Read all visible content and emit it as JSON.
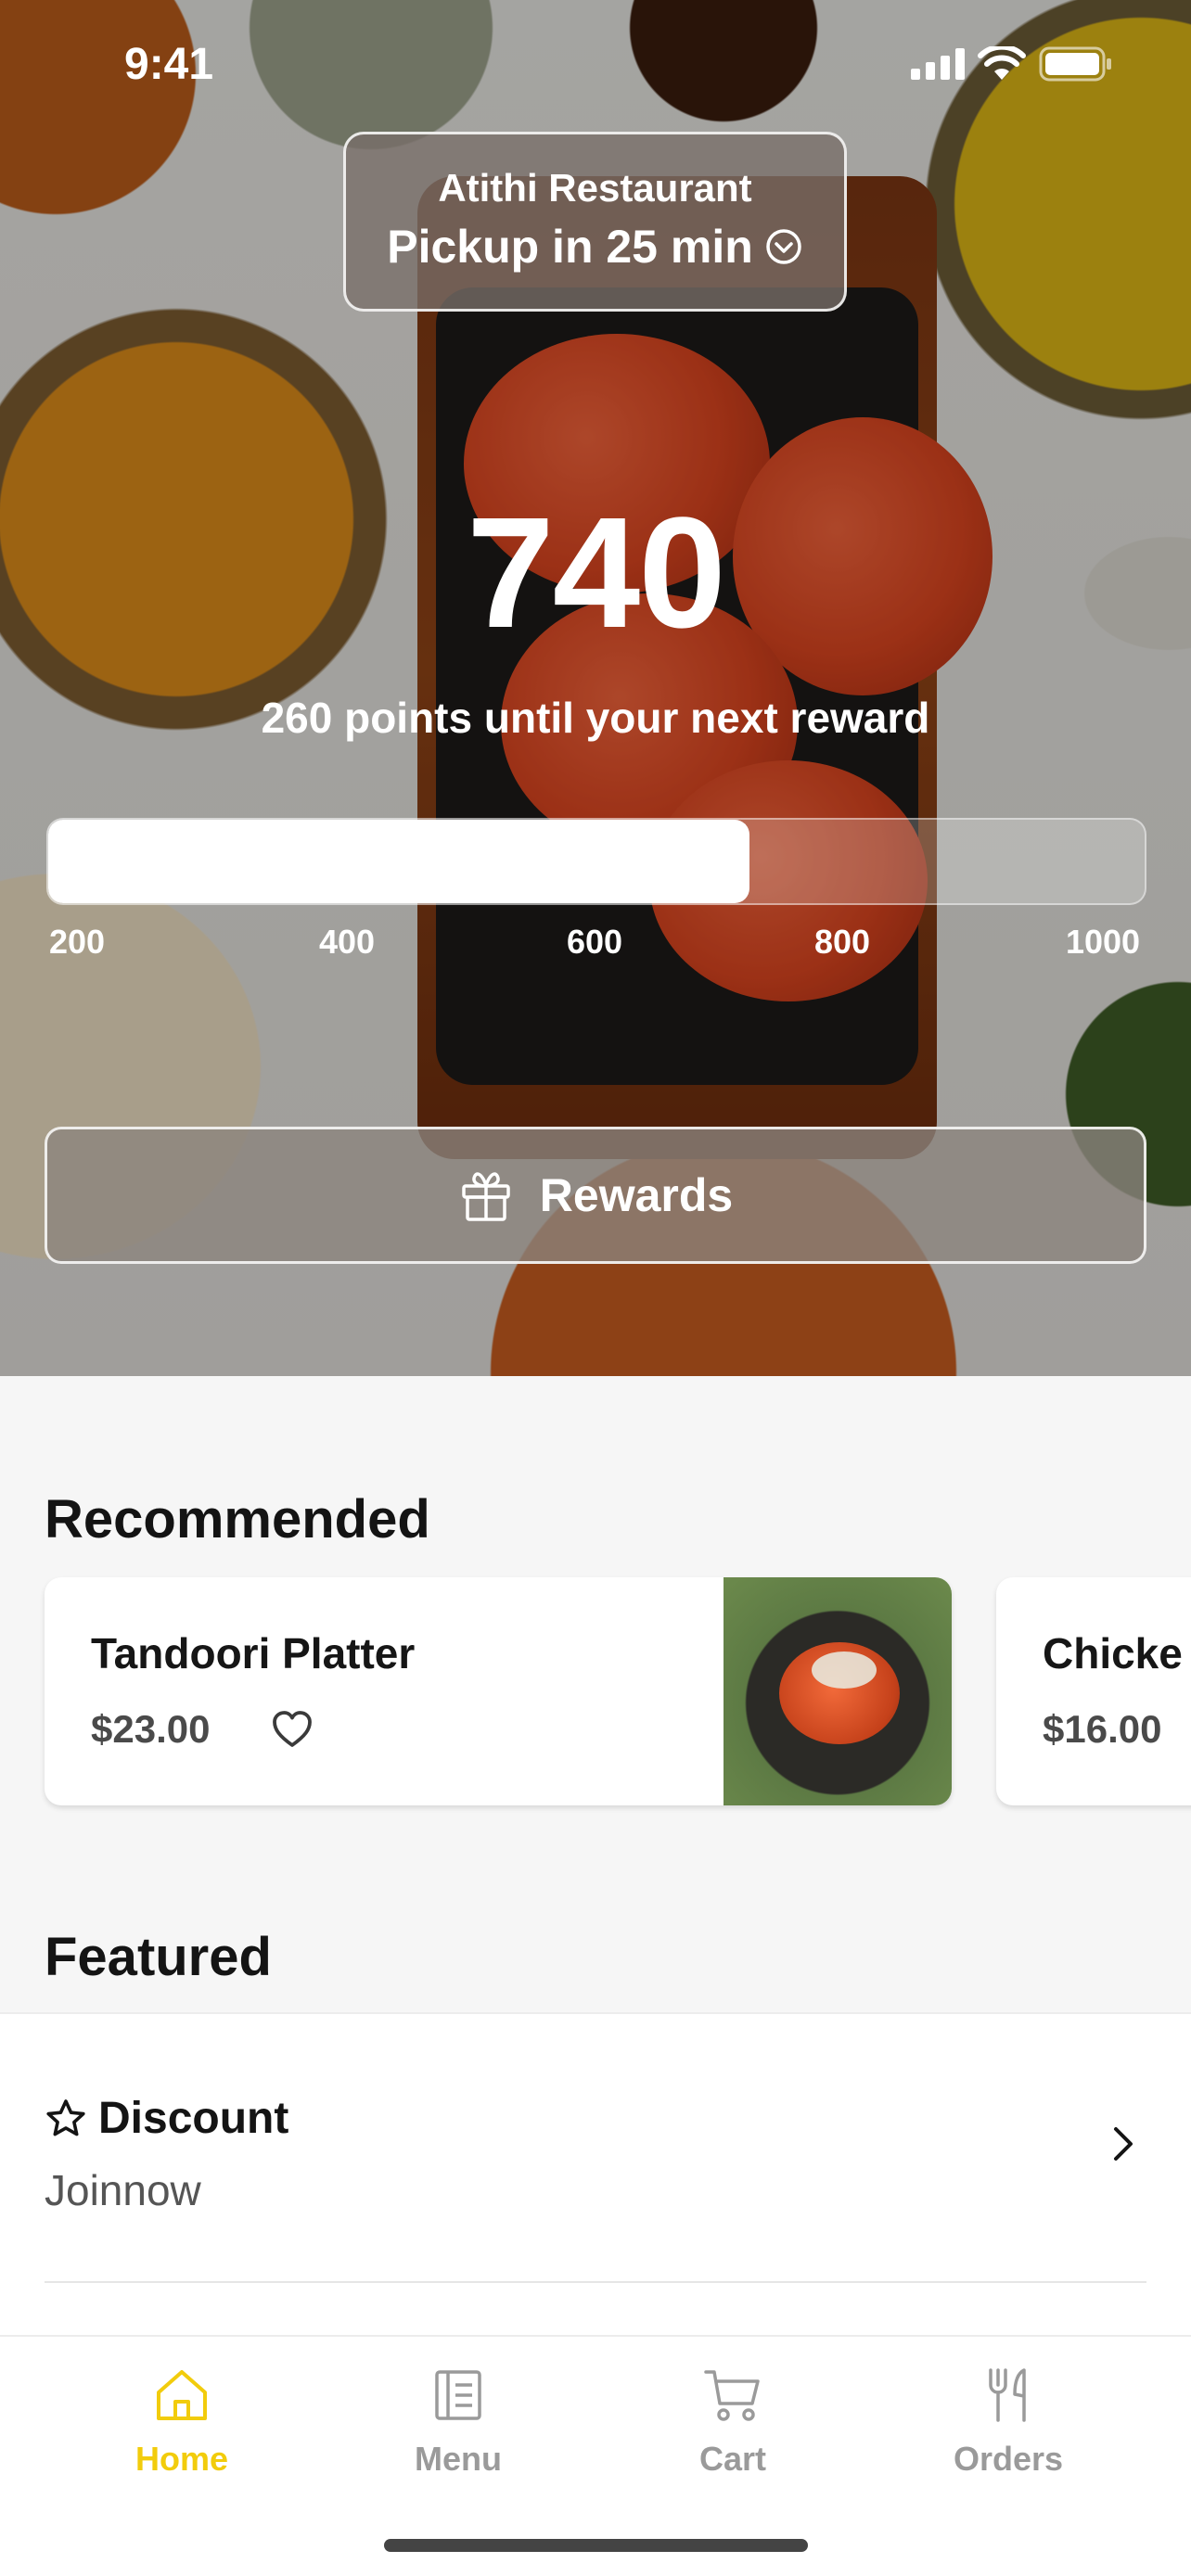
{
  "status_bar": {
    "time": "9:41"
  },
  "restaurant": {
    "name": "Atithi Restaurant",
    "pickup": "Pickup in 25 min"
  },
  "rewards": {
    "points": "740",
    "caption": "260 points until your next reward",
    "progress_fraction": 0.64,
    "ticks": [
      "200",
      "400",
      "600",
      "800",
      "1000"
    ],
    "button_label": "Rewards"
  },
  "recommended": {
    "title": "Recommended",
    "items": [
      {
        "name": "Tandoori Platter",
        "price": "$23.00"
      },
      {
        "name": "Chicke",
        "price": "$16.00"
      }
    ]
  },
  "featured": {
    "title": "Featured",
    "items": [
      {
        "title": "Discount",
        "subtitle": "Joinnow"
      }
    ]
  },
  "tabs": [
    {
      "label": "Home",
      "icon": "home-icon",
      "active": true
    },
    {
      "label": "Menu",
      "icon": "menu-icon",
      "active": false
    },
    {
      "label": "Cart",
      "icon": "cart-icon",
      "active": false
    },
    {
      "label": "Orders",
      "icon": "utensils-icon",
      "active": false
    }
  ],
  "colors": {
    "accent": "#f2cc0c",
    "inactive_tab": "#9a9a9a",
    "background": "#f6f6f6"
  }
}
